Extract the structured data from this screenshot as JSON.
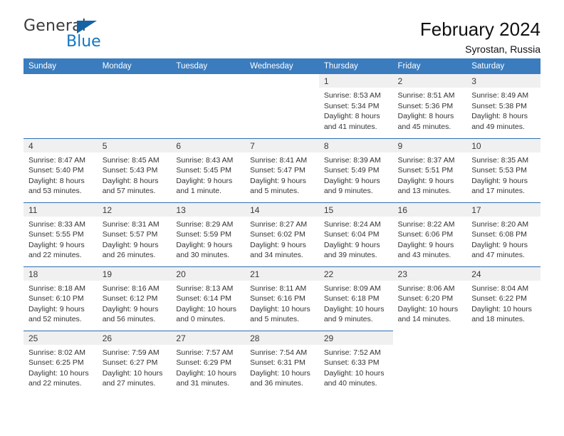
{
  "brand": {
    "name_part1": "General",
    "name_part2": "Blue"
  },
  "header": {
    "title": "February 2024",
    "subtitle": "Syrostan, Russia"
  },
  "colors": {
    "header_blue": "#3a7cbe",
    "row_rule_blue": "#2f6fb0",
    "daynum_band": "#f0f0f0",
    "logo_blue": "#1475c4"
  },
  "weekdays": [
    "Sunday",
    "Monday",
    "Tuesday",
    "Wednesday",
    "Thursday",
    "Friday",
    "Saturday"
  ],
  "weeks": [
    [
      {
        "day": "",
        "empty": true
      },
      {
        "day": "",
        "empty": true
      },
      {
        "day": "",
        "empty": true
      },
      {
        "day": "",
        "empty": true
      },
      {
        "day": "1",
        "sunrise": "Sunrise: 8:53 AM",
        "sunset": "Sunset: 5:34 PM",
        "daylight1": "Daylight: 8 hours",
        "daylight2": "and 41 minutes."
      },
      {
        "day": "2",
        "sunrise": "Sunrise: 8:51 AM",
        "sunset": "Sunset: 5:36 PM",
        "daylight1": "Daylight: 8 hours",
        "daylight2": "and 45 minutes."
      },
      {
        "day": "3",
        "sunrise": "Sunrise: 8:49 AM",
        "sunset": "Sunset: 5:38 PM",
        "daylight1": "Daylight: 8 hours",
        "daylight2": "and 49 minutes."
      }
    ],
    [
      {
        "day": "4",
        "sunrise": "Sunrise: 8:47 AM",
        "sunset": "Sunset: 5:40 PM",
        "daylight1": "Daylight: 8 hours",
        "daylight2": "and 53 minutes."
      },
      {
        "day": "5",
        "sunrise": "Sunrise: 8:45 AM",
        "sunset": "Sunset: 5:43 PM",
        "daylight1": "Daylight: 8 hours",
        "daylight2": "and 57 minutes."
      },
      {
        "day": "6",
        "sunrise": "Sunrise: 8:43 AM",
        "sunset": "Sunset: 5:45 PM",
        "daylight1": "Daylight: 9 hours",
        "daylight2": "and 1 minute."
      },
      {
        "day": "7",
        "sunrise": "Sunrise: 8:41 AM",
        "sunset": "Sunset: 5:47 PM",
        "daylight1": "Daylight: 9 hours",
        "daylight2": "and 5 minutes."
      },
      {
        "day": "8",
        "sunrise": "Sunrise: 8:39 AM",
        "sunset": "Sunset: 5:49 PM",
        "daylight1": "Daylight: 9 hours",
        "daylight2": "and 9 minutes."
      },
      {
        "day": "9",
        "sunrise": "Sunrise: 8:37 AM",
        "sunset": "Sunset: 5:51 PM",
        "daylight1": "Daylight: 9 hours",
        "daylight2": "and 13 minutes."
      },
      {
        "day": "10",
        "sunrise": "Sunrise: 8:35 AM",
        "sunset": "Sunset: 5:53 PM",
        "daylight1": "Daylight: 9 hours",
        "daylight2": "and 17 minutes."
      }
    ],
    [
      {
        "day": "11",
        "sunrise": "Sunrise: 8:33 AM",
        "sunset": "Sunset: 5:55 PM",
        "daylight1": "Daylight: 9 hours",
        "daylight2": "and 22 minutes."
      },
      {
        "day": "12",
        "sunrise": "Sunrise: 8:31 AM",
        "sunset": "Sunset: 5:57 PM",
        "daylight1": "Daylight: 9 hours",
        "daylight2": "and 26 minutes."
      },
      {
        "day": "13",
        "sunrise": "Sunrise: 8:29 AM",
        "sunset": "Sunset: 5:59 PM",
        "daylight1": "Daylight: 9 hours",
        "daylight2": "and 30 minutes."
      },
      {
        "day": "14",
        "sunrise": "Sunrise: 8:27 AM",
        "sunset": "Sunset: 6:02 PM",
        "daylight1": "Daylight: 9 hours",
        "daylight2": "and 34 minutes."
      },
      {
        "day": "15",
        "sunrise": "Sunrise: 8:24 AM",
        "sunset": "Sunset: 6:04 PM",
        "daylight1": "Daylight: 9 hours",
        "daylight2": "and 39 minutes."
      },
      {
        "day": "16",
        "sunrise": "Sunrise: 8:22 AM",
        "sunset": "Sunset: 6:06 PM",
        "daylight1": "Daylight: 9 hours",
        "daylight2": "and 43 minutes."
      },
      {
        "day": "17",
        "sunrise": "Sunrise: 8:20 AM",
        "sunset": "Sunset: 6:08 PM",
        "daylight1": "Daylight: 9 hours",
        "daylight2": "and 47 minutes."
      }
    ],
    [
      {
        "day": "18",
        "sunrise": "Sunrise: 8:18 AM",
        "sunset": "Sunset: 6:10 PM",
        "daylight1": "Daylight: 9 hours",
        "daylight2": "and 52 minutes."
      },
      {
        "day": "19",
        "sunrise": "Sunrise: 8:16 AM",
        "sunset": "Sunset: 6:12 PM",
        "daylight1": "Daylight: 9 hours",
        "daylight2": "and 56 minutes."
      },
      {
        "day": "20",
        "sunrise": "Sunrise: 8:13 AM",
        "sunset": "Sunset: 6:14 PM",
        "daylight1": "Daylight: 10 hours",
        "daylight2": "and 0 minutes."
      },
      {
        "day": "21",
        "sunrise": "Sunrise: 8:11 AM",
        "sunset": "Sunset: 6:16 PM",
        "daylight1": "Daylight: 10 hours",
        "daylight2": "and 5 minutes."
      },
      {
        "day": "22",
        "sunrise": "Sunrise: 8:09 AM",
        "sunset": "Sunset: 6:18 PM",
        "daylight1": "Daylight: 10 hours",
        "daylight2": "and 9 minutes."
      },
      {
        "day": "23",
        "sunrise": "Sunrise: 8:06 AM",
        "sunset": "Sunset: 6:20 PM",
        "daylight1": "Daylight: 10 hours",
        "daylight2": "and 14 minutes."
      },
      {
        "day": "24",
        "sunrise": "Sunrise: 8:04 AM",
        "sunset": "Sunset: 6:22 PM",
        "daylight1": "Daylight: 10 hours",
        "daylight2": "and 18 minutes."
      }
    ],
    [
      {
        "day": "25",
        "sunrise": "Sunrise: 8:02 AM",
        "sunset": "Sunset: 6:25 PM",
        "daylight1": "Daylight: 10 hours",
        "daylight2": "and 22 minutes."
      },
      {
        "day": "26",
        "sunrise": "Sunrise: 7:59 AM",
        "sunset": "Sunset: 6:27 PM",
        "daylight1": "Daylight: 10 hours",
        "daylight2": "and 27 minutes."
      },
      {
        "day": "27",
        "sunrise": "Sunrise: 7:57 AM",
        "sunset": "Sunset: 6:29 PM",
        "daylight1": "Daylight: 10 hours",
        "daylight2": "and 31 minutes."
      },
      {
        "day": "28",
        "sunrise": "Sunrise: 7:54 AM",
        "sunset": "Sunset: 6:31 PM",
        "daylight1": "Daylight: 10 hours",
        "daylight2": "and 36 minutes."
      },
      {
        "day": "29",
        "sunrise": "Sunrise: 7:52 AM",
        "sunset": "Sunset: 6:33 PM",
        "daylight1": "Daylight: 10 hours",
        "daylight2": "and 40 minutes."
      },
      {
        "day": "",
        "empty": true
      },
      {
        "day": "",
        "empty": true
      }
    ]
  ]
}
